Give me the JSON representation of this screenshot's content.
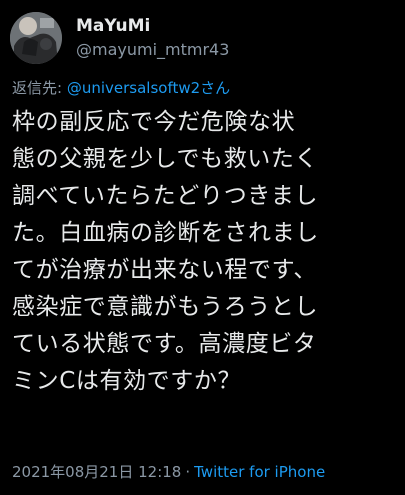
{
  "user": {
    "display_name": "MaYuMi",
    "handle": "@mayumi_mtmr43",
    "avatar_icon": "profile-photo"
  },
  "reply": {
    "prefix": "返信先:",
    "mention": "@universalsoftw2さん"
  },
  "tweet": {
    "lines": [
      "枠の副反応で今だ危険な状",
      "態の父親を少しでも救いたく",
      "調べていたらたどりつきまし",
      "た。白血病の診断をされまし",
      "てが治療が出来ない程です、",
      "感染症で意識がもうろうとし",
      "ている状態です。高濃度ビタ",
      "ミンCは有効ですか？"
    ]
  },
  "meta": {
    "timestamp": "2021年08月21日 12:18",
    "separator": "·",
    "source": "Twitter for iPhone"
  },
  "colors": {
    "background": "#000000",
    "text": "#e7e9ea",
    "secondary": "#8b98a5",
    "link": "#1d9bf0"
  }
}
